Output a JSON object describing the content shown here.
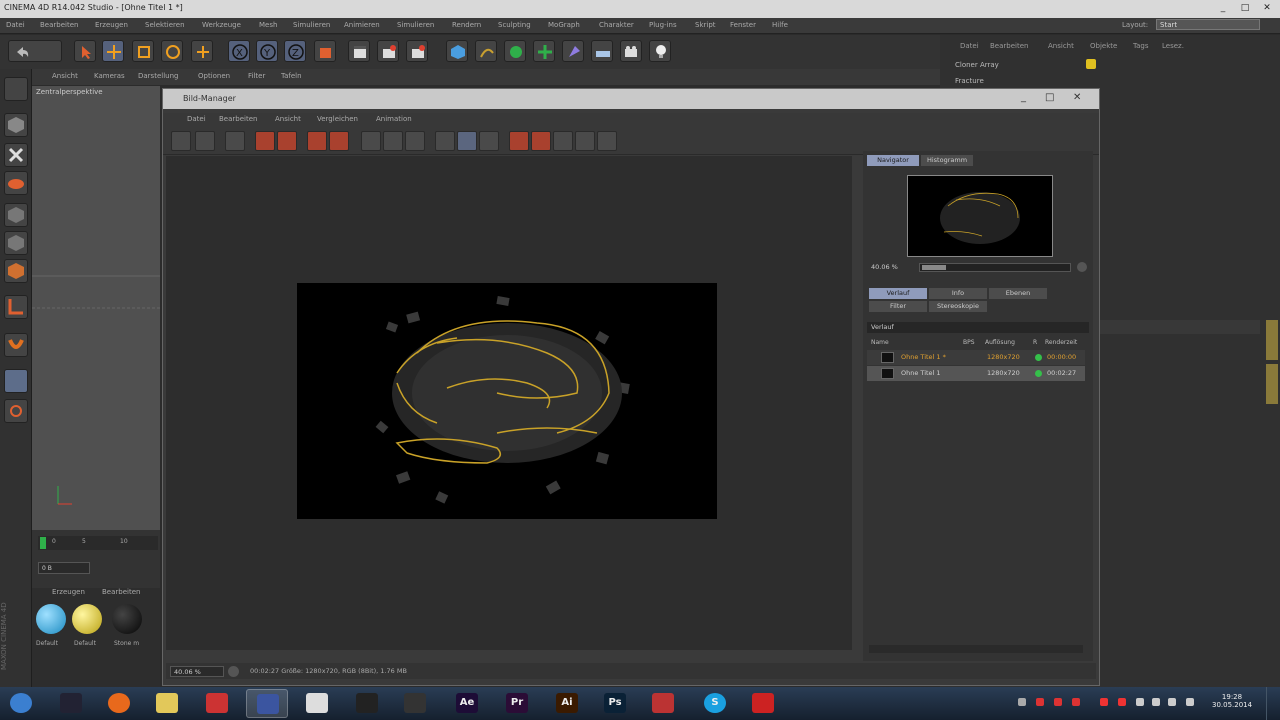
{
  "window": {
    "title": "CINEMA 4D R14.042 Studio - [Ohne Titel 1 *]",
    "min": "_",
    "max": "□",
    "close": "✕"
  },
  "menu": [
    "Datei",
    "Bearbeiten",
    "Erzeugen",
    "Selektieren",
    "Werkzeuge",
    "Mesh",
    "Simulieren",
    "Animieren",
    "Simulieren",
    "Rendern",
    "Sculpting",
    "MoGraph",
    "Charakter",
    "Plug-ins",
    "Skript",
    "Fenster",
    "Hilfe"
  ],
  "layout": {
    "label": "Layout:",
    "value": "Start"
  },
  "viewport": {
    "menu": [
      "Ansicht",
      "Kameras",
      "Darstellung",
      "Optionen",
      "Filter",
      "Tafeln"
    ],
    "label": "Zentralperspektive"
  },
  "timeline": {
    "ticks": [
      "0",
      "5",
      "10"
    ],
    "frame": "0 B"
  },
  "materials": {
    "menu": [
      "Erzeugen",
      "Bearbeiten"
    ],
    "items": [
      {
        "label": "Default",
        "color": "#2aa6d6"
      },
      {
        "label": "Default",
        "color": "#d6c21a"
      },
      {
        "label": "Stone m",
        "color": "#151515"
      }
    ]
  },
  "object_manager": {
    "menu": [
      "Datei",
      "Bearbeiten",
      "Ansicht",
      "Objekte",
      "Tags",
      "Lesez."
    ],
    "objects": [
      "Cloner Array",
      "Fracture"
    ]
  },
  "bildmanager": {
    "title": "Bild-Manager",
    "menu": [
      "Datei",
      "Bearbeiten",
      "Ansicht",
      "Vergleichen",
      "Animation"
    ],
    "tabs_top": [
      "Navigator",
      "Histogramm"
    ],
    "zoom": "40.06 %",
    "tabs_mid": [
      "Verlauf",
      "Info",
      "Ebenen",
      "Filter",
      "Stereoskopie"
    ],
    "section": "Verlauf",
    "columns": [
      "Name",
      "BPS",
      "Auflösung",
      "R",
      "Renderzeit"
    ],
    "rows": [
      {
        "name": "Ohne Titel 1 *",
        "res": "1280x720",
        "time": "00:00:00",
        "color": "#e0a030"
      },
      {
        "name": "Ohne Titel 1",
        "res": "1280x720",
        "time": "00:02:27",
        "color": "#cfcfcf"
      }
    ],
    "status_zoom": "40.06 %",
    "status_text": "00:02:27   Größe: 1280x720, RGB (8Bit), 1.76 MB"
  },
  "taskbar": {
    "time": "19:28",
    "date": "30.05.2014",
    "apps": [
      {
        "name": "start",
        "label": "",
        "color": "#3b7fd0"
      },
      {
        "name": "app",
        "label": "",
        "color": "#223"
      },
      {
        "name": "firefox",
        "label": "",
        "color": "#e8691c"
      },
      {
        "name": "explorer",
        "label": "",
        "color": "#e2c85a"
      },
      {
        "name": "app",
        "label": "",
        "color": "#c33"
      },
      {
        "name": "cinema4d",
        "label": "",
        "color": "#3b55a0"
      },
      {
        "name": "app",
        "label": "",
        "color": "#ddd"
      },
      {
        "name": "app",
        "label": "",
        "color": "#222"
      },
      {
        "name": "steam",
        "label": "",
        "color": "#333"
      },
      {
        "name": "aftereffects",
        "label": "Ae",
        "color": "#1d0c36"
      },
      {
        "name": "premiere",
        "label": "Pr",
        "color": "#2b0c36"
      },
      {
        "name": "illustrator",
        "label": "Ai",
        "color": "#3a1a00"
      },
      {
        "name": "photoshop",
        "label": "Ps",
        "color": "#0a2136"
      },
      {
        "name": "app",
        "label": "",
        "color": "#b33"
      },
      {
        "name": "skype",
        "label": "S",
        "color": "#1aa0e0"
      },
      {
        "name": "app",
        "label": "",
        "color": "#c22"
      }
    ]
  }
}
